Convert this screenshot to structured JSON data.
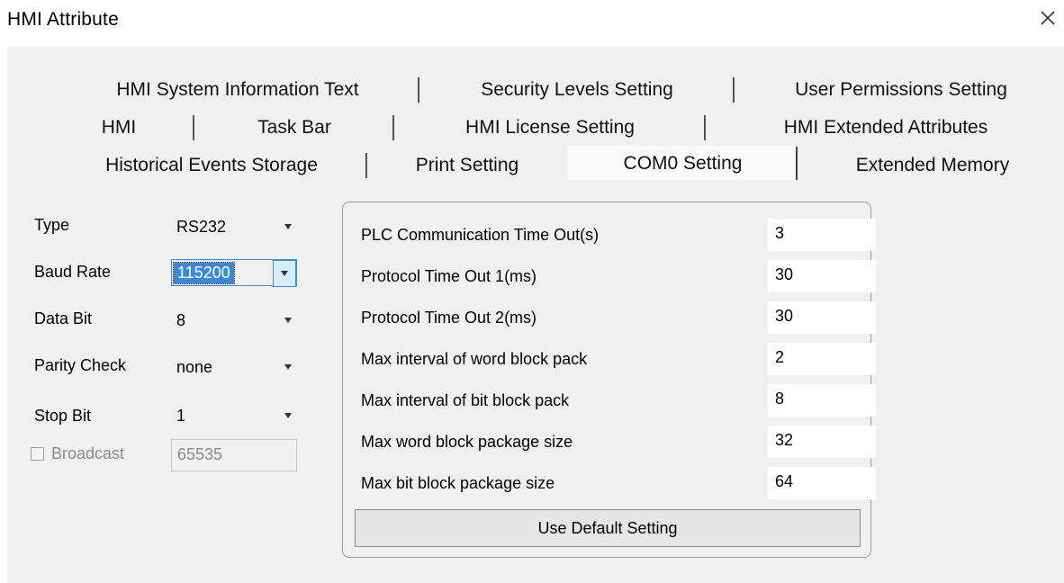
{
  "window": {
    "title": "HMI Attribute"
  },
  "tabs": {
    "row1": [
      "HMI System Information Text",
      "Security Levels Setting",
      "User Permissions Setting"
    ],
    "row2": [
      "HMI",
      "Task Bar",
      "HMI License Setting",
      "HMI Extended Attributes"
    ],
    "row3": [
      "Historical Events Storage",
      "Print Setting",
      "COM0 Setting",
      "Extended Memory"
    ],
    "active": "COM0 Setting"
  },
  "serial": {
    "type": {
      "label": "Type",
      "value": "RS232"
    },
    "baud_rate": {
      "label": "Baud Rate",
      "value": "115200"
    },
    "data_bit": {
      "label": "Data Bit",
      "value": "8"
    },
    "parity_check": {
      "label": "Parity Check",
      "value": "none"
    },
    "stop_bit": {
      "label": "Stop Bit",
      "value": "1"
    },
    "broadcast": {
      "label": "Broadcast",
      "value": "65535",
      "checked": false
    }
  },
  "timeouts": [
    {
      "label": "PLC Communication Time Out(s)",
      "value": "3"
    },
    {
      "label": "Protocol Time Out 1(ms)",
      "value": "30"
    },
    {
      "label": "Protocol Time Out 2(ms)",
      "value": "30"
    },
    {
      "label": "Max interval of word block pack",
      "value": "2"
    },
    {
      "label": "Max interval of bit block pack",
      "value": "8"
    },
    {
      "label": "Max word block package size",
      "value": "32"
    },
    {
      "label": "Max bit block package size",
      "value": "64"
    }
  ],
  "default_button": "Use Default Setting",
  "colors": {
    "selection": "#3a88d9",
    "panel": "#f0f0f0"
  }
}
